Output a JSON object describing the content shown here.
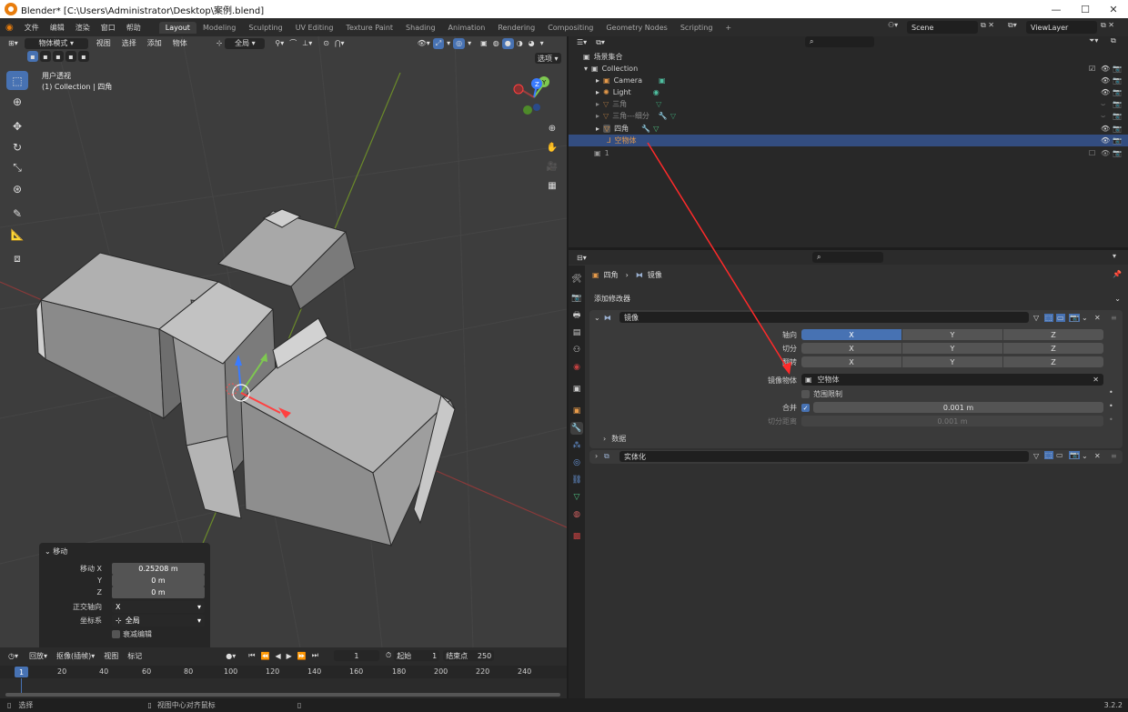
{
  "window": {
    "title": "Blender* [C:\\Users\\Administrator\\Desktop\\案例.blend]"
  },
  "menu": {
    "items": [
      "文件",
      "编辑",
      "渲染",
      "窗口",
      "帮助"
    ]
  },
  "workspaces": [
    "Layout",
    "Modeling",
    "Sculpting",
    "UV Editing",
    "Texture Paint",
    "Shading",
    "Animation",
    "Rendering",
    "Compositing",
    "Geometry Nodes",
    "Scripting"
  ],
  "active_workspace": "Layout",
  "scene": {
    "name": "Scene",
    "view_layer": "ViewLayer"
  },
  "viewport": {
    "mode": "物体模式",
    "menus": [
      "视图",
      "选择",
      "添加",
      "物体"
    ],
    "transform_orientation": "全局",
    "options_label": "选项",
    "view_name": "用户透视",
    "context": "(1) Collection | 四角"
  },
  "redo_panel": {
    "title": "移动",
    "move_x_label": "移动 X",
    "move_x": "0.25208 m",
    "y_label": "Y",
    "y": "0 m",
    "z_label": "Z",
    "z": "0 m",
    "ortho_label": "正交轴向",
    "ortho_value": "X",
    "coord_label": "坐标系",
    "coord_value": "全局",
    "prop_edit_label": "衰减编辑"
  },
  "timeline": {
    "menus": [
      "回放",
      "抠像(插帧)",
      "视图",
      "标记"
    ],
    "current_frame": "1",
    "start_label": "起始",
    "start": "1",
    "end_label": "结束点",
    "end": "250",
    "ticks": [
      "1",
      "20",
      "40",
      "60",
      "80",
      "100",
      "120",
      "140",
      "160",
      "180",
      "200",
      "220",
      "240"
    ]
  },
  "statusbar": {
    "select": "选择",
    "center": "视图中心对齐鼠标",
    "version": "3.2.2"
  },
  "outliner": {
    "root": "场景集合",
    "items": [
      {
        "name": "Collection",
        "icon": "collection-icon"
      },
      {
        "name": "Camera",
        "icon": "camera-icon"
      },
      {
        "name": "Light",
        "icon": "light-icon"
      },
      {
        "name": "三角",
        "icon": "mesh-icon"
      },
      {
        "name": "三角---细分",
        "icon": "mesh-icon"
      },
      {
        "name": "四角",
        "icon": "mesh-icon"
      },
      {
        "name": "空物体",
        "icon": "empty-icon"
      },
      {
        "name": "1",
        "icon": "collection-icon"
      }
    ]
  },
  "properties": {
    "breadcrumb_object": "四角",
    "breadcrumb_modifier": "镜像",
    "add_modifier": "添加修改器",
    "mirror": {
      "name": "镜像",
      "axis_label": "轴向",
      "bisect_label": "切分",
      "flip_label": "翻转",
      "x": "X",
      "y": "Y",
      "z": "Z",
      "mirror_object_label": "镜像物体",
      "mirror_object": "空物体",
      "clipping_label": "范围限制",
      "merge_label": "合并",
      "merge_value": "0.001 m",
      "bisect_distance_label": "切分距离",
      "bisect_distance_value": "0.001 m",
      "data_label": "数据"
    },
    "solidify": {
      "name": "实体化"
    }
  },
  "colors": {
    "accent": "#4772b3",
    "selection": "#334d80",
    "arrow": "#ff2a2a"
  }
}
